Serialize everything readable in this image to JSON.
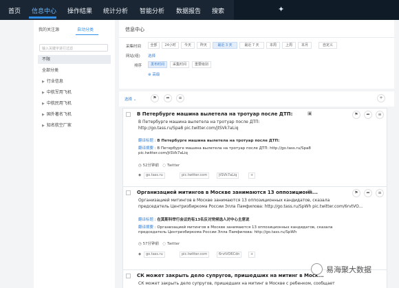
{
  "nav": {
    "items": [
      "首页",
      "信息中心",
      "操作结果",
      "统计分析",
      "智能分析",
      "数据报告",
      "搜索"
    ],
    "active_index": 1
  },
  "sidebar": {
    "tabs": [
      "我的关注源",
      "自动分类"
    ],
    "active_tab": 1,
    "filter_placeholder": "输入关键字进行过滤",
    "items": [
      {
        "label": "不限",
        "arrow": false,
        "selected": true
      },
      {
        "label": "全部分类",
        "arrow": false,
        "selected": false
      },
      {
        "label": "行业信息",
        "arrow": true,
        "selected": false
      },
      {
        "label": "中航军用飞机",
        "arrow": true,
        "selected": false
      },
      {
        "label": "中航民用飞机",
        "arrow": true,
        "selected": false
      },
      {
        "label": "国外著名飞机",
        "arrow": true,
        "selected": false
      },
      {
        "label": "知名航空厂家",
        "arrow": true,
        "selected": false
      }
    ]
  },
  "filters": {
    "title": "信息中心",
    "time_label": "采集时间",
    "time_options": [
      "全部",
      "24小时",
      "今天",
      "昨天",
      "最近 3 天",
      "最近 7 天",
      "本周",
      "上周",
      "本月",
      "自定义"
    ],
    "time_active": 4,
    "site_label": "网站(组)",
    "site_select": "选择",
    "sort_label": "排序",
    "sort_options": [
      "发布时间",
      "采集时间",
      "重要级别"
    ],
    "sort_active": 0,
    "advanced": "高级"
  },
  "toolbar": {
    "select_label": "选择"
  },
  "articles": [
    {
      "title": "В Петербурге машина вылетела на тротуар после ДТП:",
      "snippet1": "В Петербурге машина вылетела на тротуар после ДТП:",
      "snippet2": "http://go.tass.ru/Spa8 pic.twitter.com/jtSVk7aLiq",
      "trans_title_label": "翻译标题",
      "trans_title": "В Петербурге машина вылетела на тротуар после ДТП:",
      "trans_body_label": "翻译摘要",
      "trans_body1": "В Петербурге машина вылетела на тротуар после ДТП: http://go.tass.ru/Spa8",
      "trans_body2": "pic.twitter.com/jtSVk7aLiq",
      "time": "52分钟前",
      "source": "Twitter",
      "tags": [
        "go.tass.ru",
        "pic.twitter.com",
        "jtSVk7aLiq"
      ]
    },
    {
      "title": "Организацией митингов в Москве занимаются 13 оппозиционн...",
      "snippet1": "Организацией митингов в Москве занимаются 13 оппозиционных кандидатов, сказала",
      "snippet2": "председатель Центризбиркома России Элла Памфилова: http://go.tass.ru/SpWh pic.twitter.com/6rvtVO...",
      "trans_title_label": "翻译标题",
      "trans_title": "在莫斯科举行会议的有13名反对党候选人对中心主席说",
      "trans_body_label": "翻译摘要",
      "trans_body1": "Организацией митингов в Москве занимаются 13 оппозиционных кандидатов, сказала",
      "trans_body2": "председатель Центризбиркома России Элла Памфилова: http://go.tass.ru/SpWh",
      "time": "57分钟前",
      "source": "Twitter",
      "tags": [
        "go.tass.ru",
        "pic.twitter.com",
        "6rvtVO6Cdn"
      ]
    },
    {
      "title": "СК может закрыть дело супругов, пришедших на митинг в Моск...",
      "snippet1": "СК может закрыть дело супругов, пришедших на митинг в Москве с ребенком, сообщает"
    }
  ],
  "watermark": "易海聚大数据",
  "colors": {
    "nav_bg": "#1a2634",
    "accent": "#2f8fe8",
    "active_chip_bg": "#e4eefb",
    "page_bg": "#f3f4f6"
  },
  "icons": [
    "flag-icon",
    "share-icon",
    "list-icon",
    "plus-icon",
    "image-icon",
    "clock-icon",
    "tag-icon",
    "chevron-down-icon",
    "star-icon"
  ]
}
